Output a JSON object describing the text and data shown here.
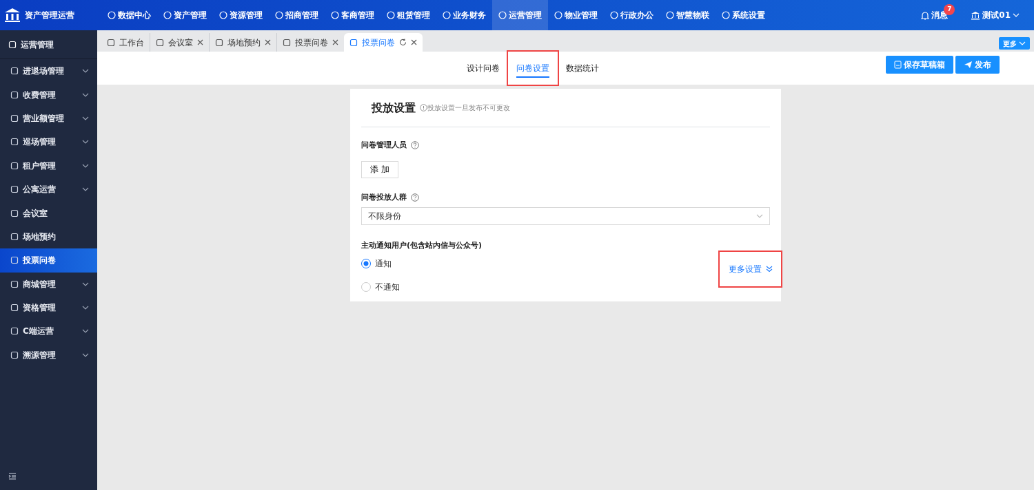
{
  "app": {
    "title": "资产管理运营"
  },
  "top_nav": [
    {
      "label": "数据中心",
      "selected": false
    },
    {
      "label": "资产管理",
      "selected": false
    },
    {
      "label": "资源管理",
      "selected": false
    },
    {
      "label": "招商管理",
      "selected": false
    },
    {
      "label": "客商管理",
      "selected": false
    },
    {
      "label": "租赁管理",
      "selected": false
    },
    {
      "label": "业务财务",
      "selected": false
    },
    {
      "label": "运营管理",
      "selected": true
    },
    {
      "label": "物业管理",
      "selected": false
    },
    {
      "label": "行政办公",
      "selected": false
    },
    {
      "label": "智慧物联",
      "selected": false
    },
    {
      "label": "系统设置",
      "selected": false
    }
  ],
  "messages": {
    "label": "消息",
    "badge": "7"
  },
  "user": {
    "name": "测试01"
  },
  "sidebar": {
    "title": "运营管理",
    "items": [
      {
        "label": "进退场管理",
        "expandable": true,
        "selected": false
      },
      {
        "label": "收费管理",
        "expandable": true,
        "selected": false
      },
      {
        "label": "营业额管理",
        "expandable": true,
        "selected": false
      },
      {
        "label": "巡场管理",
        "expandable": true,
        "selected": false
      },
      {
        "label": "租户管理",
        "expandable": true,
        "selected": false
      },
      {
        "label": "公寓运营",
        "expandable": true,
        "selected": false
      },
      {
        "label": "会议室",
        "expandable": false,
        "selected": false
      },
      {
        "label": "场地预约",
        "expandable": false,
        "selected": false
      },
      {
        "label": "投票问卷",
        "expandable": false,
        "selected": true
      },
      {
        "label": "商城管理",
        "expandable": true,
        "selected": false
      },
      {
        "label": "资格管理",
        "expandable": true,
        "selected": false
      },
      {
        "label": "C端运营",
        "expandable": true,
        "selected": false
      },
      {
        "label": "溯源管理",
        "expandable": true,
        "selected": false
      }
    ]
  },
  "page_tabs": [
    {
      "label": "工作台",
      "closable": false,
      "selected": false
    },
    {
      "label": "会议室",
      "closable": true,
      "selected": false
    },
    {
      "label": "场地预约",
      "closable": true,
      "selected": false
    },
    {
      "label": "投票问卷",
      "closable": true,
      "selected": false
    },
    {
      "label": "投票问卷",
      "closable": true,
      "selected": true
    }
  ],
  "more_tabs": "更多",
  "sub_tabs": [
    {
      "label": "设计问卷",
      "selected": false,
      "highlighted": false
    },
    {
      "label": "问卷设置",
      "selected": true,
      "highlighted": true
    },
    {
      "label": "数据统计",
      "selected": false,
      "highlighted": false
    }
  ],
  "actions": [
    "保存草稿箱",
    "发布"
  ],
  "form": {
    "title": "投放设置",
    "hint": "投放设置一旦发布不可更改",
    "managers_label": "问卷管理人员",
    "add_button": "添 加",
    "audience_label": "问卷投放人群",
    "audience_value": "不限身份",
    "notify_label": "主动通知用户(包含站内信与公众号)",
    "notify_options": [
      {
        "label": "通知",
        "selected": true
      },
      {
        "label": "不通知",
        "selected": false
      }
    ],
    "more_settings": {
      "label": "更多设置",
      "highlighted": true
    }
  }
}
